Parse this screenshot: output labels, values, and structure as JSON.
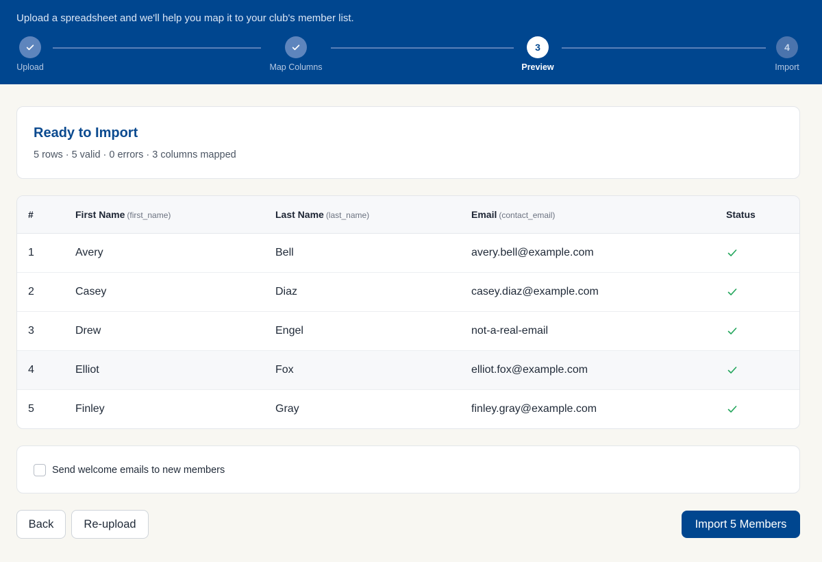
{
  "header": {
    "subtitle": "Upload a spreadsheet and we'll help you map it to your club's member list."
  },
  "steps": [
    {
      "number": "1",
      "label": "Upload",
      "state": "done"
    },
    {
      "number": "2",
      "label": "Map Columns",
      "state": "done"
    },
    {
      "number": "3",
      "label": "Preview",
      "state": "current"
    },
    {
      "number": "4",
      "label": "Import",
      "state": "upcoming"
    }
  ],
  "summary": {
    "title": "Ready to Import",
    "stats": "5 rows · 5 valid · 0 errors · 3 columns mapped"
  },
  "table": {
    "headers": {
      "index": "#",
      "first": "First Name",
      "first_field": "(first_name)",
      "last": "Last Name",
      "last_field": "(last_name)",
      "email": "Email",
      "email_field": "(contact_email)",
      "status": "Status"
    },
    "rows": [
      {
        "index": "1",
        "first": "Avery",
        "last": "Bell",
        "email": "avery.bell@example.com",
        "status": "valid"
      },
      {
        "index": "2",
        "first": "Casey",
        "last": "Diaz",
        "email": "casey.diaz@example.com",
        "status": "valid"
      },
      {
        "index": "3",
        "first": "Drew",
        "last": "Engel",
        "email": "not-a-real-email",
        "status": "valid"
      },
      {
        "index": "4",
        "first": "Elliot",
        "last": "Fox",
        "email": "elliot.fox@example.com",
        "status": "valid"
      },
      {
        "index": "5",
        "first": "Finley",
        "last": "Gray",
        "email": "finley.gray@example.com",
        "status": "valid"
      }
    ]
  },
  "options": {
    "welcome_email_label": "Send welcome emails to new members",
    "welcome_email_checked": false
  },
  "actions": {
    "back_label": "Back",
    "reupload_label": "Re-upload",
    "import_label": "Import 5 Members"
  },
  "colors": {
    "brand": "#00468f",
    "success": "#22a55b"
  },
  "icons": {
    "step_done": "check-icon",
    "row_status": "check-icon"
  }
}
